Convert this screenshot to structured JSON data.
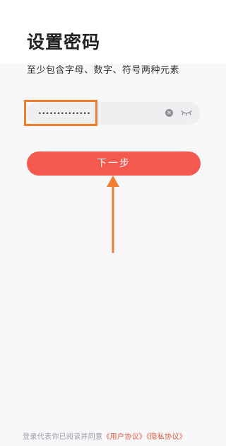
{
  "header": {
    "title": "设置密码",
    "subtitle": "至少包含字母、数字、符号两种元素"
  },
  "password_field": {
    "value": "••••••••••••••",
    "clear_icon": "close-circle-icon",
    "visibility_icon": "eye-closed-icon"
  },
  "next_button": {
    "label": "下一步"
  },
  "footer": {
    "prefix": "登录代表你已阅读并同意",
    "user_agreement": "《用户协议》",
    "privacy_agreement": "《隐私协议》"
  },
  "colors": {
    "accent": "#f4594f",
    "annotation": "#f07e2d",
    "link": "#e25c3c"
  }
}
